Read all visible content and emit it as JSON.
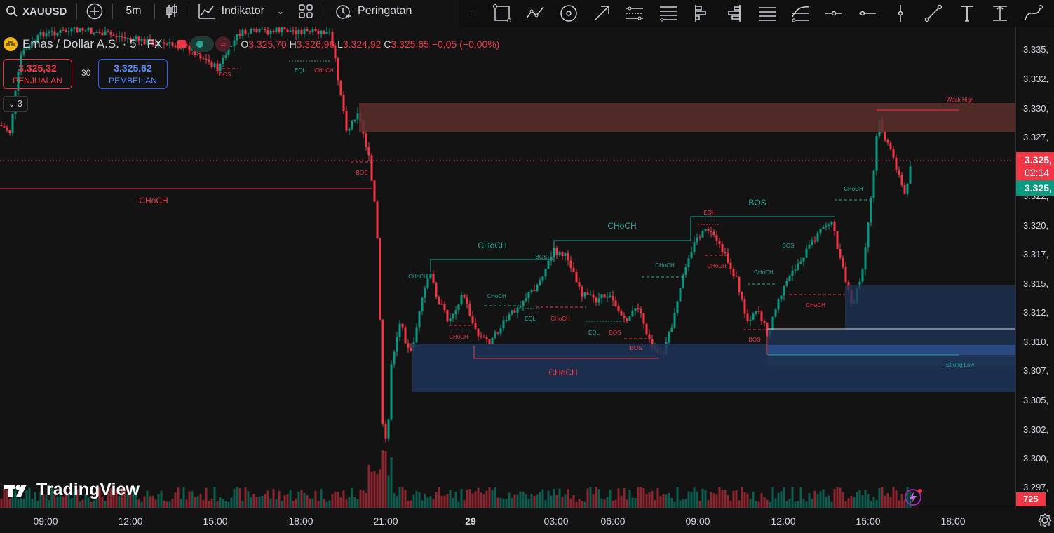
{
  "toolbar": {
    "symbol": "XAUUSD",
    "interval": "5m",
    "indicators_label": "Indikator",
    "alerts_label": "Peringatan"
  },
  "legend": {
    "title": "Emas / Dollar A.S. · 5 · FX",
    "o_key": "O",
    "o_val": "3.325,70",
    "h_key": "H",
    "h_val": "3.326,96",
    "l_key": "L",
    "l_val": "3.324,92",
    "c_key": "C",
    "c_val": "3.325,65",
    "change": "−0,05 (−0,00%)"
  },
  "trade": {
    "sell_price": "3.325,32",
    "sell_label": "PENJUALAN",
    "spread": "30",
    "buy_price": "3.325,62",
    "buy_label": "PEMBELIAN"
  },
  "collapse_count": "3",
  "logo_text": "TradingView",
  "price_axis": {
    "labels": [
      "3.335,",
      "3.332,",
      "3.330,",
      "3.327,",
      "3.325,",
      "3.322,",
      "3.320,",
      "3.317,",
      "3.315,",
      "3.312,",
      "3.310,",
      "3.307,",
      "3.305,",
      "3.302,",
      "3.300,",
      "3.297,"
    ],
    "current_price_label": "3.325,",
    "countdown": "02:14",
    "buy_price_label": "3.325,",
    "volume_label": "725"
  },
  "time_axis": [
    "09:00",
    "12:00",
    "15:00",
    "18:00",
    "21:00",
    "29",
    "03:00",
    "06:00",
    "09:00",
    "12:00",
    "15:00",
    "18:00"
  ],
  "annotations": {
    "choch_big_left": "CHoCH",
    "choch_mid1": "CHoCH",
    "choch_mid2": "CHoCH",
    "bos_mid": "BOS",
    "choch_bottom": "CHoCH",
    "weak_high": "Weak High",
    "strong_low": "Strong Low",
    "eqh": "EQH",
    "eql1": "EQL",
    "eql2": "EQL",
    "eql3": "EQL",
    "bos": "BOS",
    "choch": "CHoCH"
  },
  "colors": {
    "up": "#089981",
    "down": "#f23645",
    "bg": "#131313",
    "supply_zone": "#5b2f2b",
    "demand_zone": "#1e3458",
    "accent_blue": "#2962ff"
  }
}
